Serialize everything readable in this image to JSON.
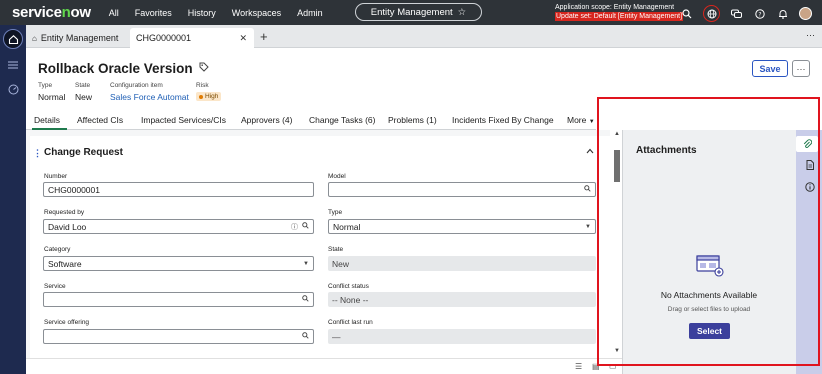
{
  "topnav": {
    "logo": "servicenow",
    "links": [
      "All",
      "Favorites",
      "History",
      "Workspaces",
      "Admin"
    ],
    "entity_pill": "Entity Management",
    "scope_line1": "Application scope: Entity Management",
    "scope_line2": "Update set: Default [Entity Management]",
    "icons": [
      "search-icon",
      "globe-icon",
      "chat-icon",
      "help-icon",
      "bell-icon",
      "avatar"
    ]
  },
  "rail": {
    "icons": [
      "home-icon",
      "list-icon",
      "dashboard-icon"
    ]
  },
  "tabs": {
    "items": [
      {
        "label": "Entity Management"
      },
      {
        "label": "CHG0000001"
      }
    ],
    "close": "✕",
    "add": "+"
  },
  "record": {
    "title": "Rollback Oracle Version",
    "type_label": "Type",
    "type_value": "Normal",
    "state_label": "State",
    "state_value": "New",
    "ci_label": "Configuration item",
    "ci_value": "Sales Force Automat",
    "risk_label": "Risk",
    "risk_value": "High",
    "save": "Save",
    "more": "···"
  },
  "form_tabs": [
    "Details",
    "Affected CIs",
    "Impacted Services/CIs",
    "Approvers (4)",
    "Change Tasks (6)",
    "Problems (1)",
    "Incidents Fixed By Change",
    "More"
  ],
  "section": {
    "title": "Change Request"
  },
  "fields": {
    "number_label": "Number",
    "number_value": "CHG0000001",
    "model_label": "Model",
    "model_value": "",
    "requested_by_label": "Requested by",
    "requested_by_value": "David Loo",
    "type_label": "Type",
    "type_value": "Normal",
    "category_label": "Category",
    "category_value": "Software",
    "state_label": "State",
    "state_value": "New",
    "service_label": "Service",
    "service_value": "",
    "conflict_status_label": "Conflict status",
    "conflict_status_value": "-- None --",
    "service_offering_label": "Service offering",
    "service_offering_value": "",
    "conflict_last_run_label": "Conflict last run",
    "conflict_last_run_value": "—"
  },
  "attachments": {
    "title": "Attachments",
    "empty": "No Attachments Available",
    "hint": "Drag or select files to upload",
    "select": "Select"
  },
  "colors": {
    "accent": "#2b56c2",
    "highlight": "#e0141e",
    "select_button": "#3b3f9c",
    "active_tab": "#1f7a4d"
  }
}
